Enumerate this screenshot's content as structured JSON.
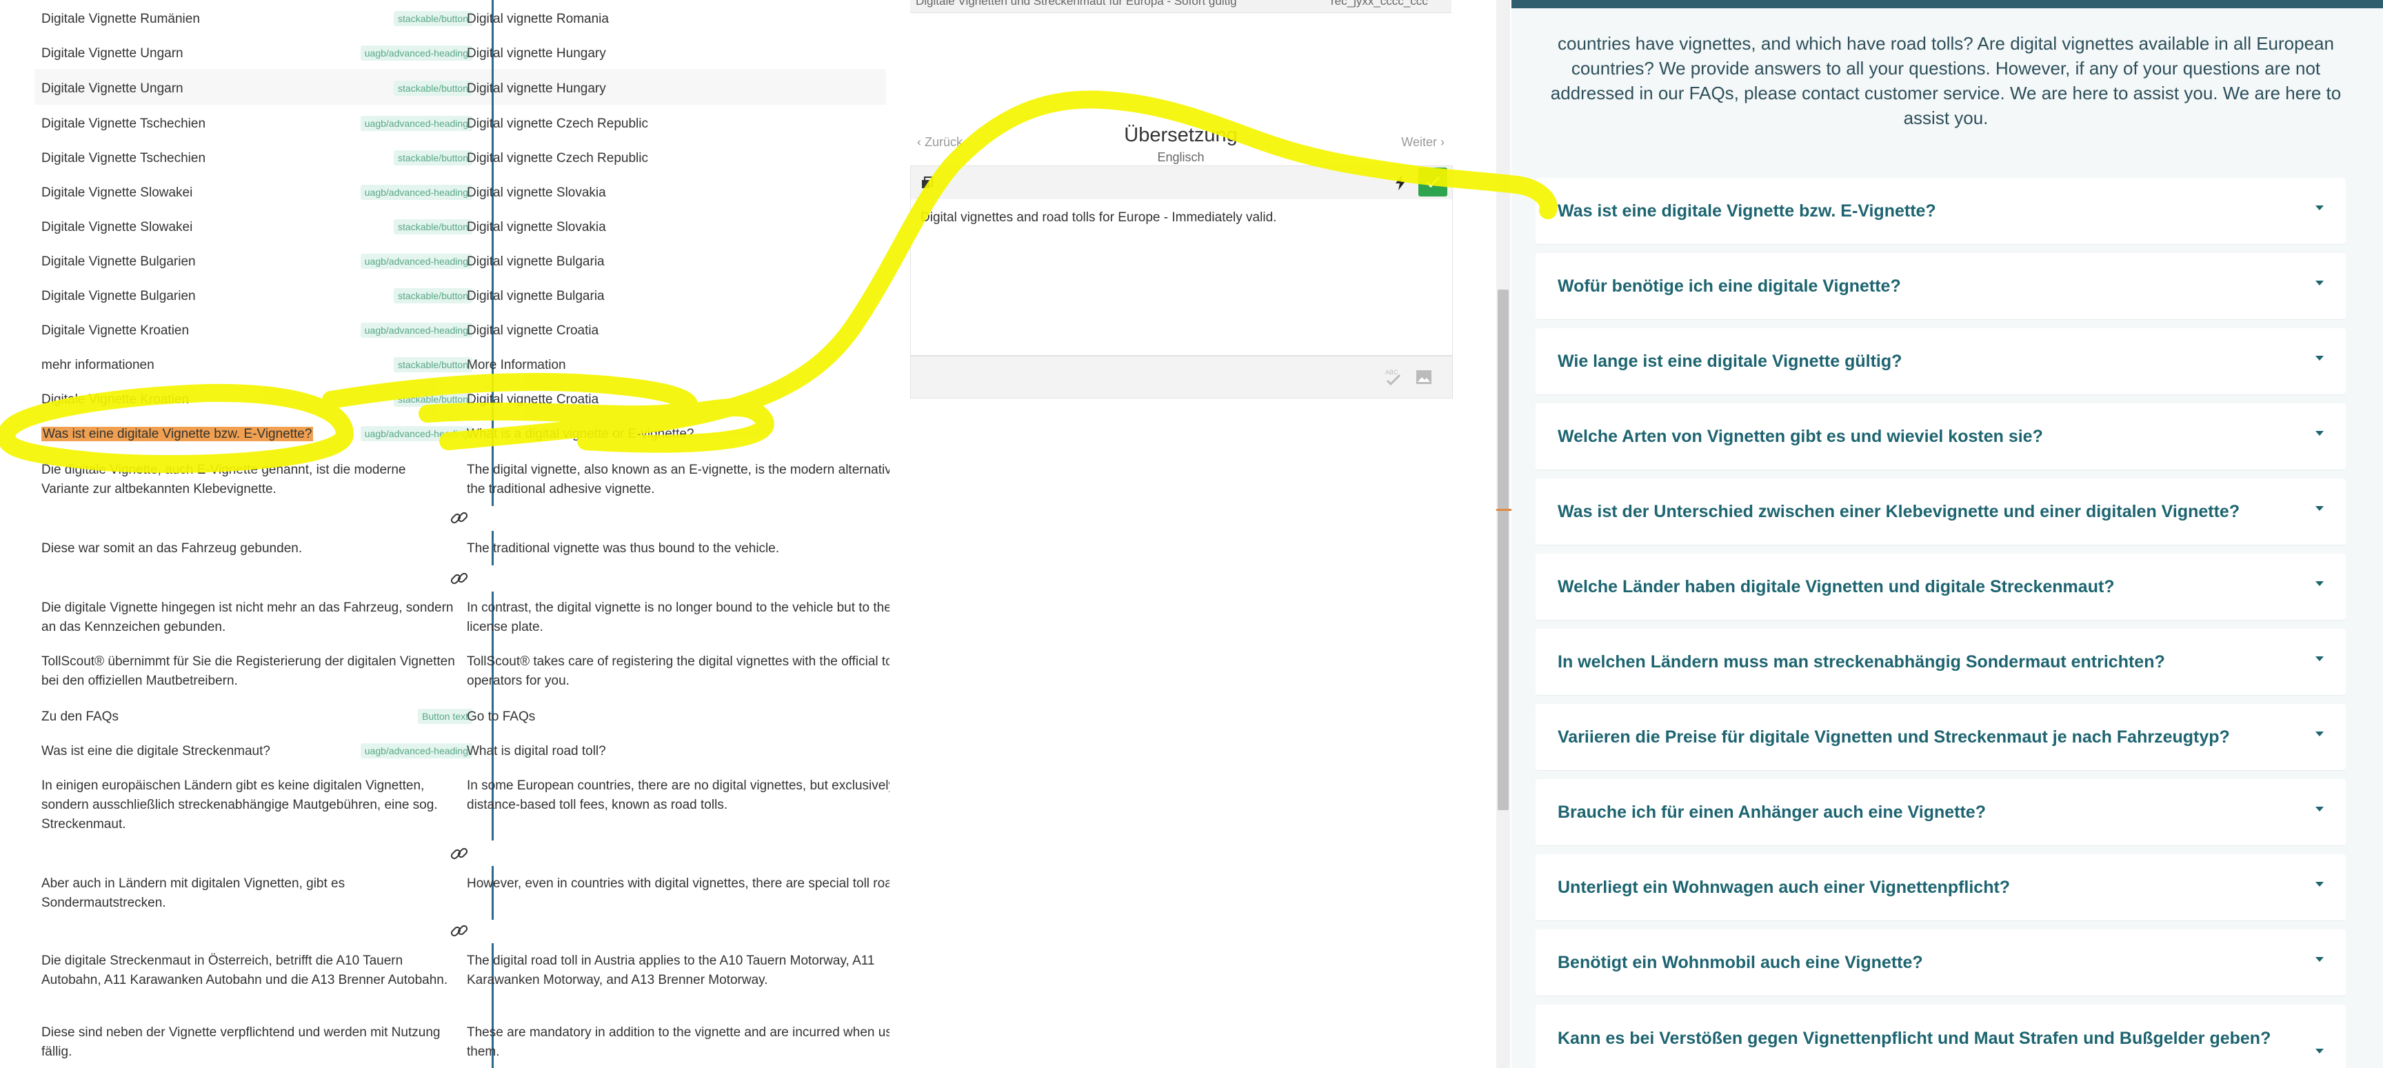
{
  "segments": [
    {
      "source": "Digitale Vignette Rumänien",
      "tag": "stackable/button",
      "target": "Digital vignette Romania"
    },
    {
      "source": "Digitale Vignette Ungarn",
      "tag": "uagb/advanced-heading",
      "target": "Digital vignette Hungary"
    },
    {
      "source": "Digitale Vignette Ungarn",
      "tag": "stackable/button",
      "target": "Digital vignette Hungary"
    },
    {
      "source": "Digitale Vignette Tschechien",
      "tag": "uagb/advanced-heading",
      "target": "Digital vignette Czech Republic"
    },
    {
      "source": "Digitale Vignette Tschechien",
      "tag": "stackable/button",
      "target": "Digital vignette Czech Republic"
    },
    {
      "source": "Digitale Vignette Slowakei",
      "tag": "uagb/advanced-heading",
      "target": "Digital vignette Slovakia"
    },
    {
      "source": "Digitale Vignette Slowakei",
      "tag": "stackable/button",
      "target": "Digital vignette Slovakia"
    },
    {
      "source": "Digitale Vignette Bulgarien",
      "tag": "uagb/advanced-heading",
      "target": "Digital vignette Bulgaria"
    },
    {
      "source": "Digitale Vignette Bulgarien",
      "tag": "stackable/button",
      "target": "Digital vignette Bulgaria"
    },
    {
      "source": "Digitale Vignette Kroatien",
      "tag": "uagb/advanced-heading",
      "target": "Digital vignette Croatia"
    },
    {
      "source": "mehr informationen",
      "tag": "stackable/button",
      "target": "More Information"
    },
    {
      "source": "Digitale Vignette Kroatien",
      "tag": "stackable/button",
      "target": "Digital vignette Croatia"
    },
    {
      "source": "Was ist eine digitale Vignette bzw. E-Vignette?",
      "tag": "uagb/advanced-heading",
      "target": "What is a digital vignette or E-vignette?"
    },
    {
      "source": "Die digitale Vignette, auch E-Vignette genannt, ist die moderne Variante zur altbekannten Klebevignette.",
      "tag": "",
      "target": "The digital vignette, also known as an E-vignette, is the modern alternative to the traditional adhesive vignette."
    },
    {
      "source": "Diese war somit an das Fahrzeug gebunden.",
      "tag": "",
      "target": "The traditional vignette was thus bound to the vehicle."
    },
    {
      "source": "Die digitale Vignette hingegen ist nicht mehr an das Fahrzeug, sondern an das Kennzeichen gebunden.",
      "tag": "",
      "target": "In contrast, the digital vignette is no longer bound to the vehicle but to the license plate."
    },
    {
      "source": "TollScout® übernimmt für Sie die Registerierung der digitalen Vignetten bei den offiziellen Mautbetreibern.",
      "tag": "",
      "target": "TollScout® takes care of registering the digital vignettes with the official toll operators for you."
    },
    {
      "source": "Zu den FAQs",
      "tag": "Button text",
      "target": "Go to FAQs"
    },
    {
      "source": "Was ist eine die digitale Streckenmaut?",
      "tag": "uagb/advanced-heading",
      "target": "What is digital road toll?"
    },
    {
      "source": "In einigen europäischen Ländern gibt es keine digitalen Vignetten, sondern ausschließlich streckenabhängige Mautgebühren, eine sog. Streckenmaut.",
      "tag": "",
      "target": "In some European countries, there are no digital vignettes, but exclusively distance-based toll fees, known as road tolls."
    },
    {
      "source": "Aber auch in Ländern mit digitalen Vignetten, gibt es Sondermautstrecken.",
      "tag": "",
      "target": "However, even in countries with digital vignettes, there are special toll roads."
    },
    {
      "source": "Die digitale Streckenmaut in Österreich, betrifft die A10 Tauern Autobahn, A11 Karawanken Autobahn und die A13 Brenner Autobahn.",
      "tag": "",
      "target": "The digital road toll in Austria applies to the A10 Tauern Motorway, A11 Karawanken Motorway, and A13 Brenner Motorway."
    },
    {
      "source": "Diese sind neben der Vignette verpflichtend und werden mit Nutzung fällig.",
      "tag": "",
      "target": "These are mandatory in addition to the vignette and are incurred when using them."
    }
  ],
  "editor": {
    "top_strip_text": "Digitale Vignetten und Streckenmaut für Europa - Sofort gültig",
    "top_strip_id": "rec_jyxx_cccc_ccc",
    "back_label": "Zurück",
    "next_label": "Weiter",
    "title": "Übersetzung",
    "language": "Englisch",
    "text": "Digital vignettes and road tolls for Europe - Immediately valid.",
    "spellcheck_label": "ABC",
    "accept_color": "#2ea44f"
  },
  "preview": {
    "intro": "countries have vignettes, and which have road tolls? Are digital vignettes available in all European countries? We provide answers to all your questions. However, if any of your questions are not addressed in our FAQs, please contact customer service. We are here to assist you. We are here to assist you.",
    "faqs": [
      "Was ist eine digitale Vignette bzw. E-Vignette?",
      "Wofür benötige ich eine digitale Vignette?",
      "Wie lange ist eine digitale Vignette gültig?",
      "Welche Arten von Vignetten gibt es und wieviel kosten sie?",
      "Was ist der Unterschied zwischen einer Klebevignette und einer digitalen Vignette?",
      "Welche Länder haben digitale Vignetten und digitale Streckenmaut?",
      "In welchen Ländern muss man streckenabhängig Sondermaut entrichten?",
      "Variieren die Preise für digitale Vignetten und Streckenmaut je nach Fahrzeugtyp?",
      "Brauche ich für einen Anhänger auch eine Vignette?",
      "Unterliegt ein Wohnwagen auch einer Vignettenpflicht?",
      "Benötigt ein Wohnmobil auch eine Vignette?",
      "Kann es bei Verstößen gegen Vignettenpflicht und Maut Strafen und Bußgelder geben?"
    ],
    "accent_color": "#1d6470"
  },
  "colors": {
    "highlight": "#f0a050",
    "tag_bg": "#e3f5ee",
    "tag_text": "#5aa788",
    "divider": "#2b6a8f",
    "scribble": "#f5f500"
  }
}
